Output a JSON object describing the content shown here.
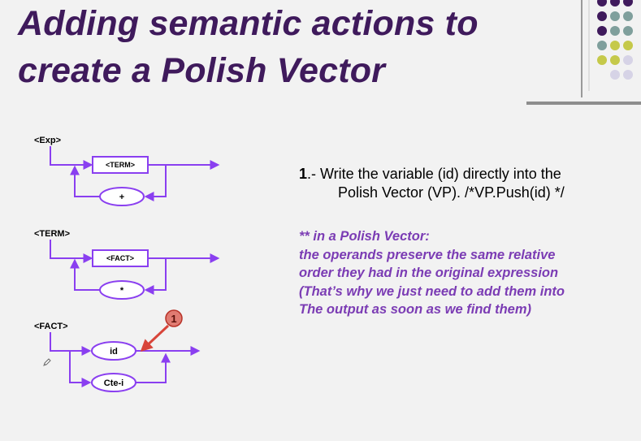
{
  "slide": {
    "title_line1": "Adding semantic actions to",
    "title_line2": "create a Polish Vector"
  },
  "diagram": {
    "exp_label": "<Exp>",
    "term_box": "<TERM>",
    "plus": "+",
    "term_label": "<TERM>",
    "fact_box": "<FACT>",
    "star": "*",
    "fact_label": "<FACT>",
    "id": "id",
    "cte": "Cte-i",
    "marker": "1"
  },
  "step": {
    "number": "1",
    "line1": ".- Write the variable (id) directly into the",
    "line2": "Polish Vector (VP). /*VP.Push(id) */"
  },
  "note": {
    "line1": "** in a Polish Vector:",
    "line2": "the operands preserve the same relative",
    "line3": "order they had in the original expression",
    "line4": "(That’s why we just need to add them into",
    "line5": "The output as soon as we find them)"
  },
  "colors": {
    "title": "#3f1a5c",
    "diagram_line": "#8a3ff0",
    "note": "#7b3cb4",
    "marker": "#d8453a",
    "dot_dark": "#3f1a5c",
    "dot_teal": "#7f9f9c",
    "dot_lime": "#c5c94a",
    "dot_lilac": "#d6d3e6"
  }
}
